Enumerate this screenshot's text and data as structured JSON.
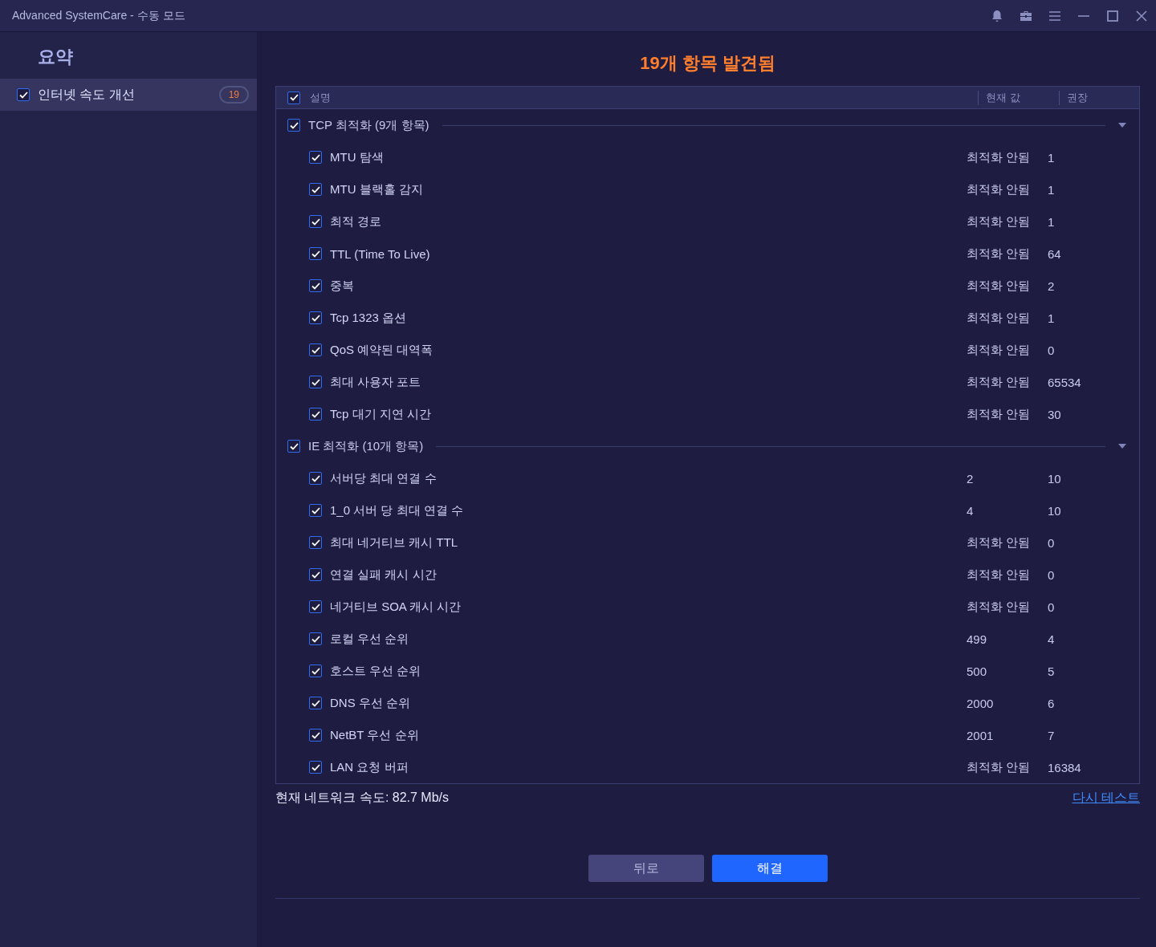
{
  "window": {
    "title": "Advanced SystemCare - 수동 모드"
  },
  "sidebar": {
    "title": "요약",
    "items": [
      {
        "label": "인터넷 속도 개선",
        "count": "19",
        "checked": true,
        "selected": true
      }
    ]
  },
  "heading": "19개 항목 발견됨",
  "table": {
    "all_checked": true,
    "columns": [
      "설명",
      "현재 값",
      "권장"
    ],
    "groups": [
      {
        "label": "TCP 최적화 (9개 항목)",
        "checked": true,
        "expanded": true,
        "rows": [
          {
            "name": "MTU 탐색",
            "current": "최적화 안됨",
            "recommended": "1",
            "checked": true
          },
          {
            "name": "MTU 블랙홀 감지",
            "current": "최적화 안됨",
            "recommended": "1",
            "checked": true
          },
          {
            "name": "최적 경로",
            "current": "최적화 안됨",
            "recommended": "1",
            "checked": true
          },
          {
            "name": "TTL (Time To Live)",
            "current": "최적화 안됨",
            "recommended": "64",
            "checked": true
          },
          {
            "name": "중복",
            "current": "최적화 안됨",
            "recommended": "2",
            "checked": true
          },
          {
            "name": "Tcp 1323 옵션",
            "current": "최적화 안됨",
            "recommended": "1",
            "checked": true
          },
          {
            "name": "QoS 예약된 대역폭",
            "current": "최적화 안됨",
            "recommended": "0",
            "checked": true
          },
          {
            "name": "최대 사용자 포트",
            "current": "최적화 안됨",
            "recommended": "65534",
            "checked": true
          },
          {
            "name": "Tcp 대기 지연 시간",
            "current": "최적화 안됨",
            "recommended": "30",
            "checked": true
          }
        ]
      },
      {
        "label": "IE 최적화 (10개 항목)",
        "checked": true,
        "expanded": true,
        "rows": [
          {
            "name": "서버당 최대 연결 수",
            "current": "2",
            "recommended": "10",
            "checked": true
          },
          {
            "name": "1_0 서버 당 최대 연결 수",
            "current": "4",
            "recommended": "10",
            "checked": true
          },
          {
            "name": "최대 네거티브 캐시 TTL",
            "current": "최적화 안됨",
            "recommended": "0",
            "checked": true
          },
          {
            "name": "연결 실패 캐시 시간",
            "current": "최적화 안됨",
            "recommended": "0",
            "checked": true
          },
          {
            "name": "네거티브 SOA 캐시 시간",
            "current": "최적화 안됨",
            "recommended": "0",
            "checked": true
          },
          {
            "name": "로컬 우선 순위",
            "current": "499",
            "recommended": "4",
            "checked": true
          },
          {
            "name": "호스트 우선 순위",
            "current": "500",
            "recommended": "5",
            "checked": true
          },
          {
            "name": "DNS 우선 순위",
            "current": "2000",
            "recommended": "6",
            "checked": true
          },
          {
            "name": "NetBT 우선 순위",
            "current": "2001",
            "recommended": "7",
            "checked": true
          },
          {
            "name": "LAN 요청 버퍼",
            "current": "최적화 안됨",
            "recommended": "16384",
            "checked": true
          }
        ]
      }
    ]
  },
  "status": {
    "speed": "현재 네트워크 속도: 82.7 Mb/s",
    "retest_link": "다시 테스트"
  },
  "buttons": [
    {
      "label": "뒤로",
      "kind": "secondary"
    },
    {
      "label": "해결",
      "kind": "primary"
    }
  ]
}
